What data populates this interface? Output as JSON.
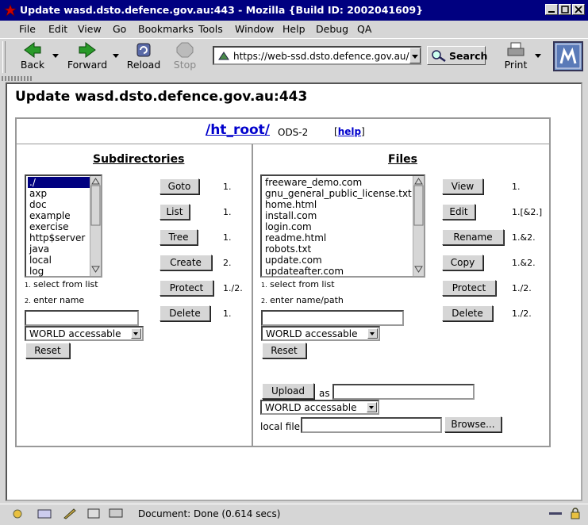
{
  "window": {
    "title": "Update wasd.dsto.defence.gov.au:443 - Mozilla {Build ID: 2002041609}"
  },
  "menu": [
    "File",
    "Edit",
    "View",
    "Go",
    "Bookmarks",
    "Tools",
    "Window",
    "Help",
    "Debug",
    "QA"
  ],
  "toolbar": {
    "back": "Back",
    "forward": "Forward",
    "reload": "Reload",
    "stop": "Stop",
    "url": "https://web-ssd.dsto.defence.gov.au/up",
    "search": "Search",
    "print": "Print"
  },
  "page": {
    "heading": "Update wasd.dsto.defence.gov.au:443",
    "path": "/ht_root/",
    "ods": "ODS-2",
    "help_open": "[",
    "help": "help",
    "help_close": "]"
  },
  "subdirs": {
    "title": "Subdirectories",
    "items": [
      "./",
      "axp",
      "doc",
      "example",
      "exercise",
      "http$server",
      "java",
      "local",
      "log"
    ],
    "selected_index": 0,
    "buttons": [
      {
        "label": "Goto",
        "note": "1."
      },
      {
        "label": "List",
        "note": "1."
      },
      {
        "label": "Tree",
        "note": "1."
      },
      {
        "label": "Create",
        "note": "2."
      },
      {
        "label": "Protect",
        "note": "1./2."
      },
      {
        "label": "Delete",
        "note": "1."
      }
    ],
    "hint1_num": "1.",
    "hint1": "select from list",
    "hint2_num": "2.",
    "hint2": "enter name",
    "name_value": "",
    "protection": "WORLD accessable",
    "reset": "Reset"
  },
  "files": {
    "title": "Files",
    "items": [
      "freeware_demo.com",
      "gnu_general_public_license.txt",
      "home.html",
      "install.com",
      "login.com",
      "readme.html",
      "robots.txt",
      "update.com",
      "updateafter.com"
    ],
    "buttons": [
      {
        "label": "View",
        "note": "1."
      },
      {
        "label": "Edit",
        "note": "1.[&2.]"
      },
      {
        "label": "Rename",
        "note": "1.&2."
      },
      {
        "label": "Copy",
        "note": "1.&2."
      },
      {
        "label": "Protect",
        "note": "1./2."
      },
      {
        "label": "Delete",
        "note": "1./2."
      }
    ],
    "hint1_num": "1.",
    "hint1": "select from list",
    "hint2_num": "2.",
    "hint2": "enter name/path",
    "name_value": "",
    "protection": "WORLD accessable",
    "reset": "Reset",
    "upload": "Upload",
    "as": "as",
    "as_value": "",
    "upload_protection": "WORLD accessable",
    "local_file": "local file",
    "local_file_value": "",
    "browse": "Browse..."
  },
  "status": {
    "text": "Document: Done (0.614 secs)"
  },
  "colors": {
    "titlebar": "#000080",
    "link": "#0000cc",
    "selection": "#000080"
  }
}
